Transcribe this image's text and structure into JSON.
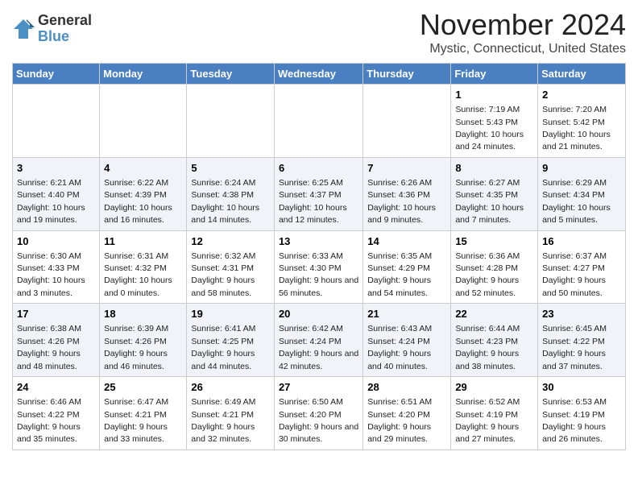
{
  "logo": {
    "general": "General",
    "blue": "Blue"
  },
  "title": "November 2024",
  "location": "Mystic, Connecticut, United States",
  "days_of_week": [
    "Sunday",
    "Monday",
    "Tuesday",
    "Wednesday",
    "Thursday",
    "Friday",
    "Saturday"
  ],
  "weeks": [
    [
      {
        "day": "",
        "info": ""
      },
      {
        "day": "",
        "info": ""
      },
      {
        "day": "",
        "info": ""
      },
      {
        "day": "",
        "info": ""
      },
      {
        "day": "",
        "info": ""
      },
      {
        "day": "1",
        "info": "Sunrise: 7:19 AM\nSunset: 5:43 PM\nDaylight: 10 hours and 24 minutes."
      },
      {
        "day": "2",
        "info": "Sunrise: 7:20 AM\nSunset: 5:42 PM\nDaylight: 10 hours and 21 minutes."
      }
    ],
    [
      {
        "day": "3",
        "info": "Sunrise: 6:21 AM\nSunset: 4:40 PM\nDaylight: 10 hours and 19 minutes."
      },
      {
        "day": "4",
        "info": "Sunrise: 6:22 AM\nSunset: 4:39 PM\nDaylight: 10 hours and 16 minutes."
      },
      {
        "day": "5",
        "info": "Sunrise: 6:24 AM\nSunset: 4:38 PM\nDaylight: 10 hours and 14 minutes."
      },
      {
        "day": "6",
        "info": "Sunrise: 6:25 AM\nSunset: 4:37 PM\nDaylight: 10 hours and 12 minutes."
      },
      {
        "day": "7",
        "info": "Sunrise: 6:26 AM\nSunset: 4:36 PM\nDaylight: 10 hours and 9 minutes."
      },
      {
        "day": "8",
        "info": "Sunrise: 6:27 AM\nSunset: 4:35 PM\nDaylight: 10 hours and 7 minutes."
      },
      {
        "day": "9",
        "info": "Sunrise: 6:29 AM\nSunset: 4:34 PM\nDaylight: 10 hours and 5 minutes."
      }
    ],
    [
      {
        "day": "10",
        "info": "Sunrise: 6:30 AM\nSunset: 4:33 PM\nDaylight: 10 hours and 3 minutes."
      },
      {
        "day": "11",
        "info": "Sunrise: 6:31 AM\nSunset: 4:32 PM\nDaylight: 10 hours and 0 minutes."
      },
      {
        "day": "12",
        "info": "Sunrise: 6:32 AM\nSunset: 4:31 PM\nDaylight: 9 hours and 58 minutes."
      },
      {
        "day": "13",
        "info": "Sunrise: 6:33 AM\nSunset: 4:30 PM\nDaylight: 9 hours and 56 minutes."
      },
      {
        "day": "14",
        "info": "Sunrise: 6:35 AM\nSunset: 4:29 PM\nDaylight: 9 hours and 54 minutes."
      },
      {
        "day": "15",
        "info": "Sunrise: 6:36 AM\nSunset: 4:28 PM\nDaylight: 9 hours and 52 minutes."
      },
      {
        "day": "16",
        "info": "Sunrise: 6:37 AM\nSunset: 4:27 PM\nDaylight: 9 hours and 50 minutes."
      }
    ],
    [
      {
        "day": "17",
        "info": "Sunrise: 6:38 AM\nSunset: 4:26 PM\nDaylight: 9 hours and 48 minutes."
      },
      {
        "day": "18",
        "info": "Sunrise: 6:39 AM\nSunset: 4:26 PM\nDaylight: 9 hours and 46 minutes."
      },
      {
        "day": "19",
        "info": "Sunrise: 6:41 AM\nSunset: 4:25 PM\nDaylight: 9 hours and 44 minutes."
      },
      {
        "day": "20",
        "info": "Sunrise: 6:42 AM\nSunset: 4:24 PM\nDaylight: 9 hours and 42 minutes."
      },
      {
        "day": "21",
        "info": "Sunrise: 6:43 AM\nSunset: 4:24 PM\nDaylight: 9 hours and 40 minutes."
      },
      {
        "day": "22",
        "info": "Sunrise: 6:44 AM\nSunset: 4:23 PM\nDaylight: 9 hours and 38 minutes."
      },
      {
        "day": "23",
        "info": "Sunrise: 6:45 AM\nSunset: 4:22 PM\nDaylight: 9 hours and 37 minutes."
      }
    ],
    [
      {
        "day": "24",
        "info": "Sunrise: 6:46 AM\nSunset: 4:22 PM\nDaylight: 9 hours and 35 minutes."
      },
      {
        "day": "25",
        "info": "Sunrise: 6:47 AM\nSunset: 4:21 PM\nDaylight: 9 hours and 33 minutes."
      },
      {
        "day": "26",
        "info": "Sunrise: 6:49 AM\nSunset: 4:21 PM\nDaylight: 9 hours and 32 minutes."
      },
      {
        "day": "27",
        "info": "Sunrise: 6:50 AM\nSunset: 4:20 PM\nDaylight: 9 hours and 30 minutes."
      },
      {
        "day": "28",
        "info": "Sunrise: 6:51 AM\nSunset: 4:20 PM\nDaylight: 9 hours and 29 minutes."
      },
      {
        "day": "29",
        "info": "Sunrise: 6:52 AM\nSunset: 4:19 PM\nDaylight: 9 hours and 27 minutes."
      },
      {
        "day": "30",
        "info": "Sunrise: 6:53 AM\nSunset: 4:19 PM\nDaylight: 9 hours and 26 minutes."
      }
    ]
  ]
}
